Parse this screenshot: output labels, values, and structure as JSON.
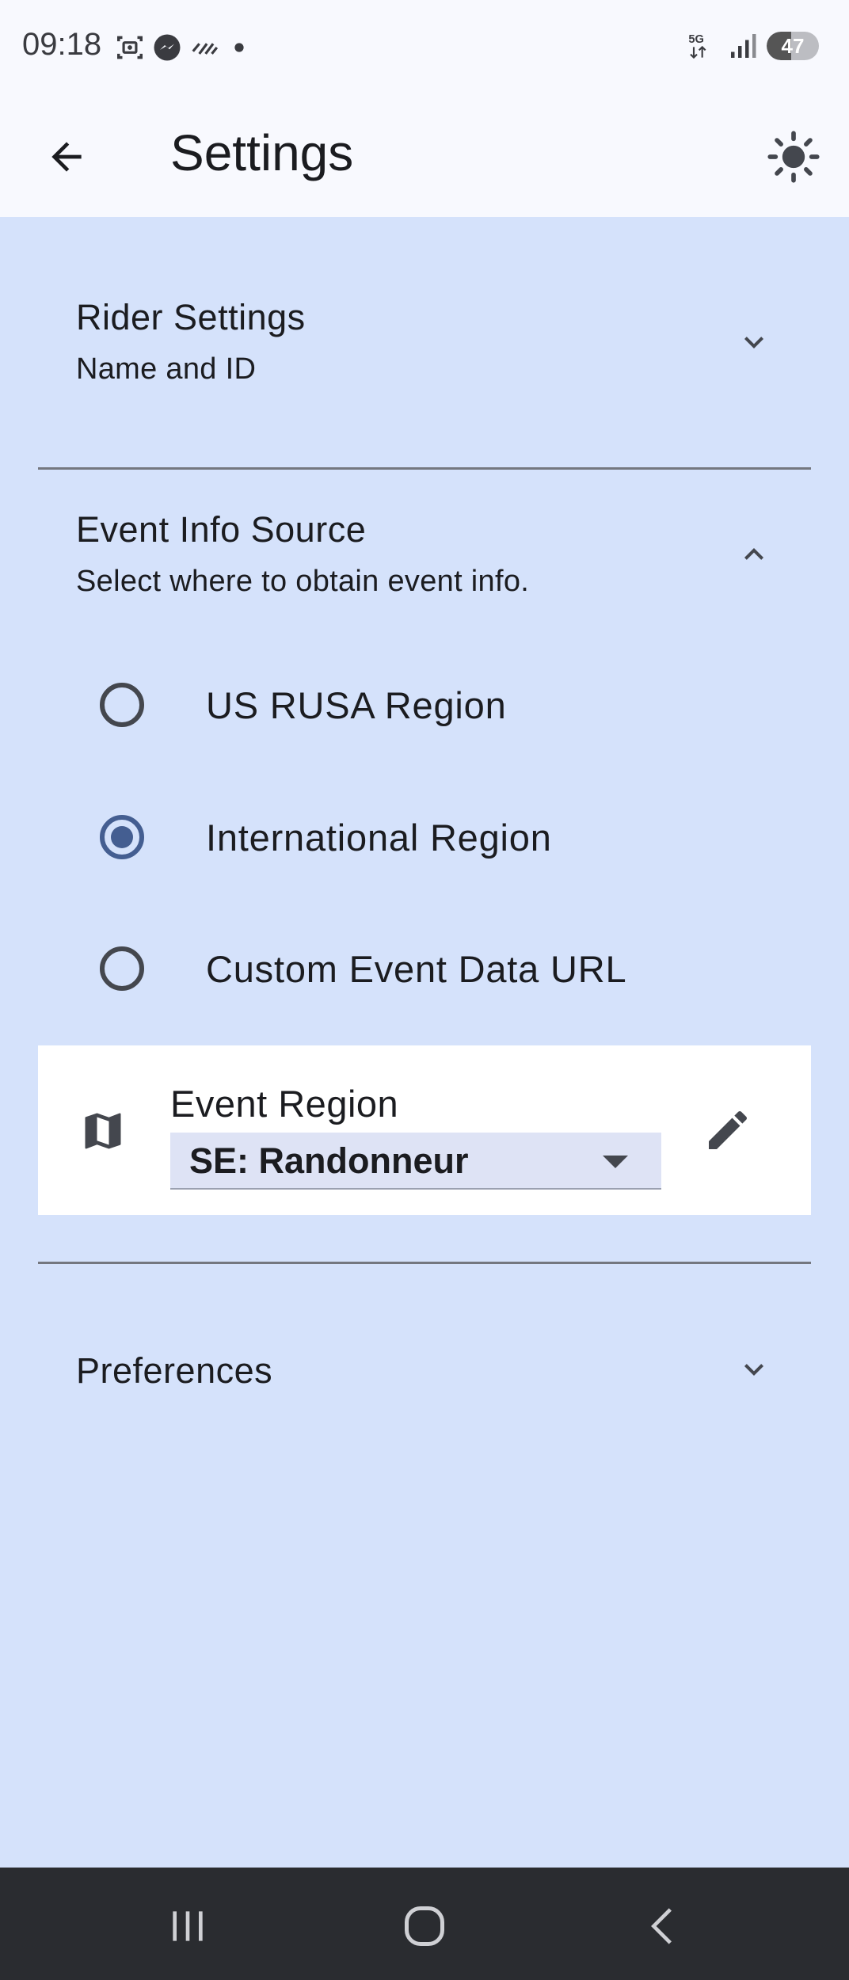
{
  "status_bar": {
    "time": "09:18",
    "left_icons": [
      "screenshot-icon",
      "messenger-icon",
      "data-saver-icon",
      "notification-dot-icon"
    ],
    "network_label": "5G",
    "battery_level": "47",
    "battery_fraction": 0.47
  },
  "app_bar": {
    "title": "Settings",
    "back_icon": "arrow-back-icon",
    "theme_icon": "sun-icon"
  },
  "sections": {
    "rider": {
      "title": "Rider Settings",
      "subtitle": "Name and ID",
      "expanded": false
    },
    "event_info": {
      "title": "Event Info Source",
      "subtitle": "Select where to obtain event info.",
      "expanded": true,
      "options": [
        {
          "label": "US RUSA Region",
          "selected": false
        },
        {
          "label": "International Region",
          "selected": true
        },
        {
          "label": "Custom Event Data URL",
          "selected": false
        }
      ],
      "region": {
        "label": "Event Region",
        "value": "SE: Randonneur",
        "map_icon": "map-icon",
        "edit_icon": "pencil-icon"
      }
    },
    "preferences": {
      "title": "Preferences",
      "expanded": false
    }
  },
  "colors": {
    "background": "#d5e2fb",
    "app_bar": "#f8f9fe",
    "accent": "#445e91",
    "nav_bar": "#2a2c30"
  },
  "nav_bar": {
    "buttons": [
      "recent-apps-icon",
      "home-icon",
      "back-icon"
    ]
  }
}
